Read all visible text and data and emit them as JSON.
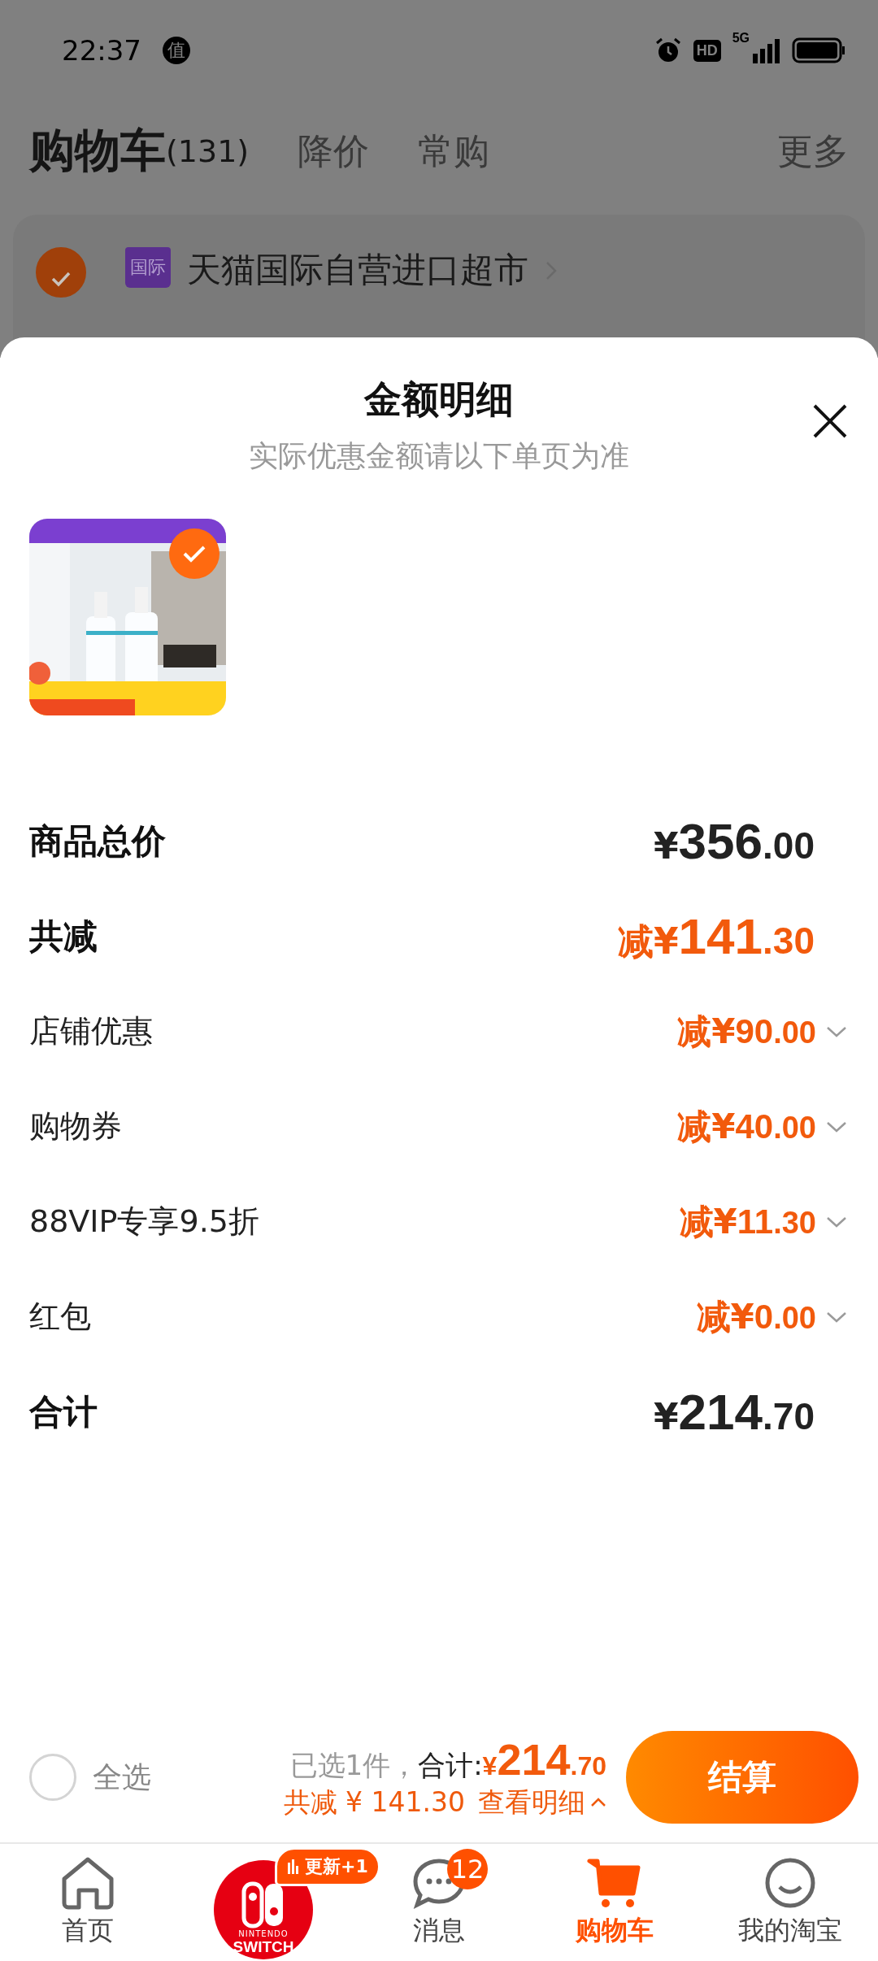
{
  "status_bar": {
    "time": "22:37",
    "notification_glyph": "值",
    "hd_badge": "HD",
    "network": "5G"
  },
  "header": {
    "title": "购物车",
    "count": "(131)",
    "tabs": [
      {
        "label": "降价",
        "selected": false
      },
      {
        "label": "常购",
        "selected": false
      }
    ],
    "more": "更多"
  },
  "store": {
    "checked": true,
    "tag": "国际",
    "name": "天猫国际自营进口超市"
  },
  "sheet": {
    "title": "金额明细",
    "subtitle": "实际优惠金额请以下单页为准",
    "products": [
      {
        "kind": "picture",
        "checked": true
      }
    ],
    "rows": [
      {
        "kind": "total",
        "label": "商品总价",
        "prefix": "¥",
        "integer": "356",
        "decimal": ".00",
        "discount": false
      },
      {
        "kind": "total",
        "label": "共减",
        "prefix": "减¥",
        "integer": "141",
        "decimal": ".30",
        "discount": true
      },
      {
        "kind": "detail",
        "label": "店铺优惠",
        "prefix": "减¥",
        "integer": "90",
        "decimal": ".00",
        "expanded": false
      },
      {
        "kind": "detail",
        "label": "购物券",
        "prefix": "减¥",
        "integer": "40",
        "decimal": ".00",
        "expanded": false
      },
      {
        "kind": "detail",
        "label": "88VIP专享9.5折",
        "prefix": "减¥",
        "integer": "11",
        "decimal": ".30",
        "expanded": false
      },
      {
        "kind": "detail",
        "label": "红包",
        "prefix": "减¥",
        "integer": "0",
        "decimal": ".00",
        "expanded": false
      },
      {
        "kind": "total",
        "label": "合计",
        "prefix": "¥",
        "integer": "214",
        "decimal": ".70",
        "discount": false
      }
    ]
  },
  "checkout_bar": {
    "select_all": {
      "label": "全选",
      "checked": false
    },
    "selected_count": "已选1件，",
    "total_label": "合计:",
    "total_prefix": "¥",
    "total_integer": "214",
    "total_decimal": ".70",
    "savings": "共减 ¥ 141.30",
    "details_link": "查看明细",
    "button": "结算"
  },
  "tab_bar": [
    {
      "kind": "home",
      "label": "首页",
      "selected": false
    },
    {
      "kind": "promo",
      "logo_top": "NINTENDO",
      "logo_bottom": "SWITCH",
      "badge": "更新+1"
    },
    {
      "kind": "messages",
      "label": "消息",
      "badge": "12",
      "selected": false
    },
    {
      "kind": "cart",
      "label": "购物车",
      "selected": true
    },
    {
      "kind": "profile",
      "label": "我的淘宝",
      "selected": false
    }
  ]
}
